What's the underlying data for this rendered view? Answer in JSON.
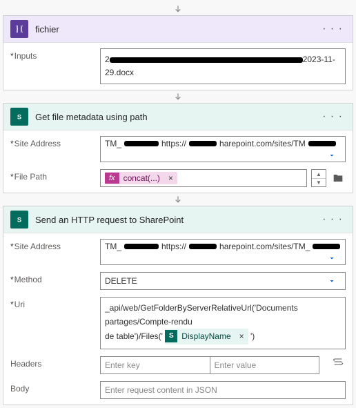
{
  "card1": {
    "title": "fichier",
    "inputs_label": "Inputs",
    "inputs_prefix": "2",
    "inputs_suffix": "2023-11-29.docx"
  },
  "card2": {
    "title": "Get file metadata using path",
    "site_label": "Site Address",
    "site_prefix": "TM_",
    "site_mid": "https://",
    "site_suffix": "harepoint.com/sites/TM",
    "filepath_label": "File Path",
    "fx_label": "concat(...)"
  },
  "card3": {
    "title": "Send an HTTP request to SharePoint",
    "site_label": "Site Address",
    "site_prefix": "TM_",
    "site_mid": "https://",
    "site_suffix": "harepoint.com/sites/TM_",
    "method_label": "Method",
    "method_value": "DELETE",
    "uri_label": "Uri",
    "uri_line1": "_api/web/GetFolderByServerRelativeUrl('Documents partages/Compte-rendu",
    "uri_line2a": "de table')/Files('",
    "uri_chip": "DisplayName",
    "uri_line2b": "')",
    "headers_label": "Headers",
    "headers_key_ph": "Enter key",
    "headers_val_ph": "Enter value",
    "body_label": "Body",
    "body_ph": "Enter request content in JSON"
  }
}
